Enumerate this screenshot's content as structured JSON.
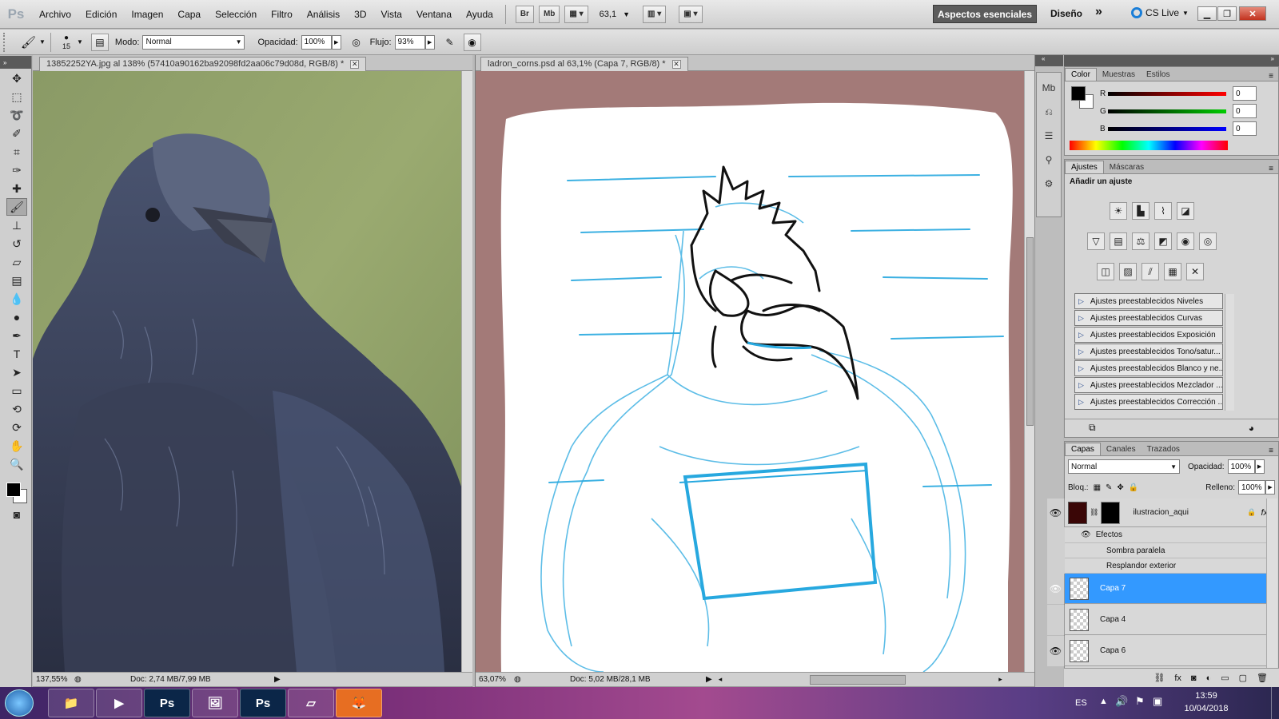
{
  "app": {
    "logo": "Ps"
  },
  "menu": [
    "Archivo",
    "Edición",
    "Imagen",
    "Capa",
    "Selección",
    "Filtro",
    "Análisis",
    "3D",
    "Vista",
    "Ventana",
    "Ayuda"
  ],
  "menubar_tools": {
    "br": "Br",
    "mb": "Mb",
    "zoom_value": "63,1"
  },
  "workspace": {
    "essentials": "Aspectos esenciales",
    "design": "Diseño",
    "more": "»",
    "cs_live": "CS Live"
  },
  "options": {
    "brush_size": "15",
    "mode_label": "Modo:",
    "mode_value": "Normal",
    "opacity_label": "Opacidad:",
    "opacity_value": "100%",
    "flow_label": "Flujo:",
    "flow_value": "93%"
  },
  "doc1": {
    "tab": "13852252YA.jpg al 138% (57410a90162ba92098fd2aa06c79d08d, RGB/8) *",
    "zoom": "137,55%",
    "doc_info": "Doc: 2,74 MB/7,99 MB"
  },
  "doc2": {
    "tab": "ladron_corns.psd al 63,1% (Capa 7, RGB/8) *",
    "zoom": "63,07%",
    "doc_info": "Doc: 5,02 MB/28,1 MB"
  },
  "color_panel": {
    "tabs": [
      "Color",
      "Muestras",
      "Estilos"
    ],
    "channels": [
      {
        "label": "R",
        "value": "0"
      },
      {
        "label": "G",
        "value": "0"
      },
      {
        "label": "B",
        "value": "0"
      }
    ]
  },
  "adjust_panel": {
    "tabs": [
      "Ajustes",
      "Máscaras"
    ],
    "title": "Añadir un ajuste",
    "presets": [
      "Ajustes preestablecidos Niveles",
      "Ajustes preestablecidos Curvas",
      "Ajustes preestablecidos Exposición",
      "Ajustes preestablecidos Tono/satur...",
      "Ajustes preestablecidos Blanco y ne...",
      "Ajustes preestablecidos Mezclador ...",
      "Ajustes preestablecidos Corrección ..."
    ]
  },
  "layers_panel": {
    "tabs": [
      "Capas",
      "Canales",
      "Trazados"
    ],
    "blend_mode": "Normal",
    "opacity_label": "Opacidad:",
    "opacity_value": "100%",
    "lock_label": "Bloq.:",
    "fill_label": "Relleno:",
    "fill_value": "100%",
    "main_layer": "ilustracion_aqui",
    "effects_label": "Efectos",
    "effects": [
      "Sombra paralela",
      "Resplandor exterior"
    ],
    "layers": [
      {
        "name": "Capa 7",
        "visible": true,
        "selected": true
      },
      {
        "name": "Capa 4",
        "visible": false,
        "selected": false
      },
      {
        "name": "Capa 6",
        "visible": true,
        "selected": false
      }
    ]
  },
  "taskbar": {
    "language": "ES",
    "time": "13:59",
    "date": "10/04/2018",
    "apps": [
      "windows-start",
      "explorer",
      "media-player",
      "photoshop",
      "image-viewer",
      "photoshop",
      "notepad",
      "firefox"
    ]
  },
  "colors": {
    "selected_layer": "#3399ff",
    "canvas_border": "#a37a78",
    "sketch_blue": "#27a8df",
    "foreground": "#000000",
    "background": "#ffffff"
  }
}
